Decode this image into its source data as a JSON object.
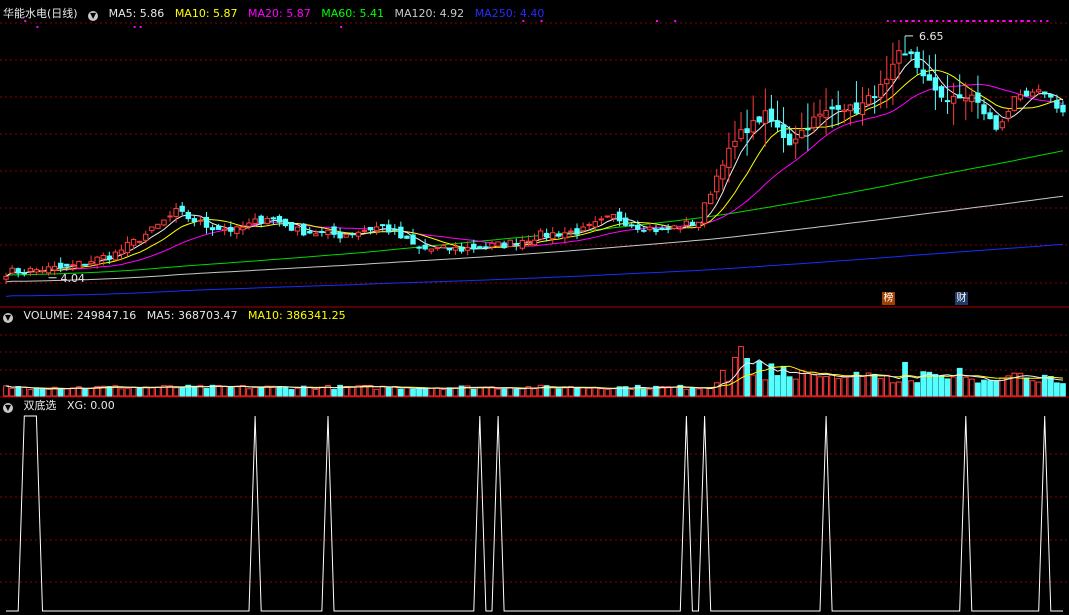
{
  "title": "华能水电(日线)",
  "price_header": {
    "ma5": {
      "label": "MA5: 5.86",
      "color": "#e8e8e8"
    },
    "ma10": {
      "label": "MA10: 5.87",
      "color": "#ffff00"
    },
    "ma20": {
      "label": "MA20: 5.87",
      "color": "#ff00ff"
    },
    "ma60": {
      "label": "MA60: 5.41",
      "color": "#00ff00"
    },
    "ma120": {
      "label": "MA120: 4.92",
      "color": "#c8c8c8"
    },
    "ma250": {
      "label": "MA250: 4.40",
      "color": "#0000ff"
    }
  },
  "volume_header": {
    "vol": {
      "label": "VOLUME: 249847.16",
      "color": "#e8e8e8"
    },
    "ma5": {
      "label": "MA5: 368703.47",
      "color": "#e8e8e8"
    },
    "ma10": {
      "label": "MA10: 386341.25",
      "color": "#ffff00"
    }
  },
  "indicator_header": {
    "name": "双底选",
    "xg": "XG: 0.00"
  },
  "annotations": {
    "high_label": "6.65",
    "low_label": "4.04"
  },
  "flags": [
    "榜",
    "财"
  ],
  "colors": {
    "up": "#ff3c3c",
    "down": "#54ffff",
    "grid": "#8b0000",
    "axis": "#b00000",
    "signal": "#ffffff",
    "marker": "#ff00ff"
  },
  "chart_data": [
    {
      "type": "candlestick",
      "title": "华能水电(日线)",
      "count": 175,
      "ylim": [
        3.8,
        6.8
      ],
      "high": 6.65,
      "low": 4.04,
      "moving_averages_latest": {
        "MA5": 5.86,
        "MA10": 5.87,
        "MA20": 5.87,
        "MA60": 5.41,
        "MA120": 4.92,
        "MA250": 4.4
      },
      "anchors": [
        [
          0,
          4.1
        ],
        [
          10,
          4.15
        ],
        [
          18,
          4.3
        ],
        [
          24,
          4.55
        ],
        [
          28,
          4.75
        ],
        [
          33,
          4.6
        ],
        [
          38,
          4.55
        ],
        [
          43,
          4.7
        ],
        [
          48,
          4.55
        ],
        [
          55,
          4.5
        ],
        [
          62,
          4.6
        ],
        [
          68,
          4.35
        ],
        [
          75,
          4.35
        ],
        [
          82,
          4.4
        ],
        [
          88,
          4.5
        ],
        [
          95,
          4.55
        ],
        [
          100,
          4.7
        ],
        [
          104,
          4.6
        ],
        [
          108,
          4.55
        ],
        [
          114,
          4.65
        ],
        [
          118,
          5.3
        ],
        [
          121,
          5.6
        ],
        [
          125,
          5.8
        ],
        [
          129,
          5.5
        ],
        [
          133,
          5.75
        ],
        [
          137,
          5.9
        ],
        [
          140,
          5.85
        ],
        [
          145,
          6.15
        ],
        [
          148,
          6.6
        ],
        [
          151,
          6.2
        ],
        [
          155,
          5.95
        ],
        [
          159,
          6.0
        ],
        [
          163,
          5.65
        ],
        [
          166,
          5.95
        ],
        [
          171,
          6.05
        ],
        [
          174,
          5.83
        ]
      ]
    },
    {
      "type": "bar",
      "title": "VOLUME",
      "count": 175,
      "latest": 249847.16,
      "ma5": 368703.47,
      "ma10": 386341.25,
      "ylim": [
        0,
        1500000
      ],
      "spikes": [
        [
          118,
          520000
        ],
        [
          120,
          780000
        ],
        [
          121,
          1000000
        ],
        [
          122,
          760000
        ],
        [
          124,
          700000
        ],
        [
          126,
          650000
        ],
        [
          128,
          600000
        ],
        [
          131,
          520000
        ],
        [
          136,
          430000
        ],
        [
          140,
          480000
        ],
        [
          145,
          420000
        ],
        [
          148,
          680000
        ],
        [
          152,
          480000
        ],
        [
          157,
          560000
        ],
        [
          161,
          320000
        ]
      ]
    },
    {
      "type": "line",
      "title": "双底选",
      "xg": 0.0,
      "ylim": [
        0,
        1
      ],
      "signals": [
        [
          3,
          1
        ],
        [
          4,
          1
        ],
        [
          5,
          1
        ],
        [
          41,
          1
        ],
        [
          53,
          1
        ],
        [
          78,
          1
        ],
        [
          81,
          1
        ],
        [
          112,
          1
        ],
        [
          115,
          1
        ],
        [
          135,
          1
        ],
        [
          158,
          1
        ],
        [
          171,
          1
        ]
      ]
    }
  ]
}
